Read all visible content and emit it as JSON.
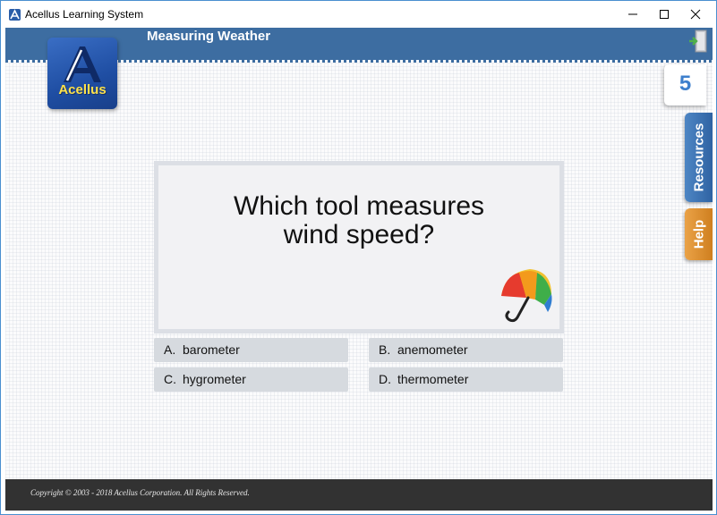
{
  "window": {
    "title": "Acellus Learning System"
  },
  "header": {
    "lesson_title": "Measuring Weather",
    "exit_icon": "exit-door-icon"
  },
  "logo": {
    "text": "Acellus",
    "letter": "A"
  },
  "score": {
    "value": "5"
  },
  "side_tabs": {
    "resources_label": "Resources",
    "help_label": "Help"
  },
  "question": {
    "line1": "Which tool measures",
    "line2": "wind speed?",
    "illustration": "umbrella-icon"
  },
  "answers": [
    {
      "letter": "A.",
      "text": "barometer"
    },
    {
      "letter": "B.",
      "text": "anemometer"
    },
    {
      "letter": "C.",
      "text": "hygrometer"
    },
    {
      "letter": "D.",
      "text": "thermometer"
    }
  ],
  "footer": {
    "copyright": "Copyright © 2003 - 2018 Acellus Corporation.  All Rights Reserved."
  },
  "colors": {
    "header": "#3d6da1",
    "score_text": "#3d7fcc",
    "resources_tab": "#3a72b5",
    "help_tab": "#e0922f",
    "answer_bg": "#d6dadf",
    "footer": "#323232"
  }
}
